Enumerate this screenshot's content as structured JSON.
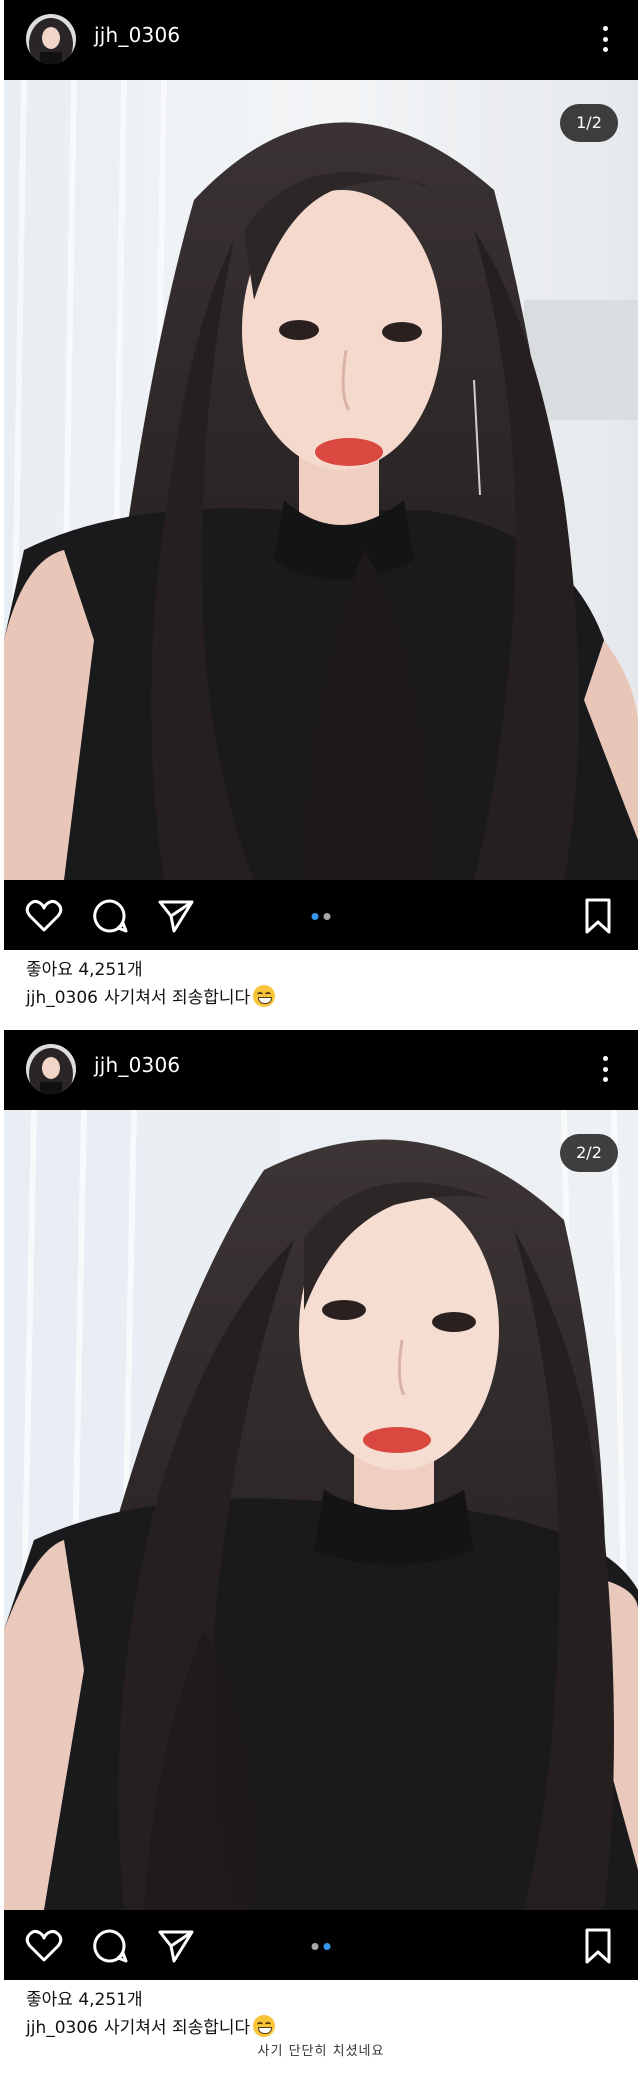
{
  "posts": [
    {
      "username": "jjh_0306",
      "counter": "1/2",
      "likes": "좋아요 4,251개",
      "caption_user": "jjh_0306",
      "caption_text": "사기쳐서 죄송합니다",
      "active_dot": 0
    },
    {
      "username": "jjh_0306",
      "counter": "2/2",
      "likes": "좋아요 4,251개",
      "caption_user": "jjh_0306",
      "caption_text": "사기쳐서 죄송합니다",
      "active_dot": 1
    }
  ],
  "footer": {
    "caption": "사기 단단히 치셨네요"
  },
  "icons": {
    "more": "more-options-icon",
    "like": "heart-icon",
    "comment": "comment-icon",
    "share": "send-icon",
    "save": "bookmark-icon",
    "emoji": "grinning-sweat-emoji"
  },
  "colors": {
    "bar_background": "#000000",
    "icon": "#ffffff",
    "dot_active": "#3897f0",
    "dot_inactive": "#a8a8a8",
    "counter_bg": "#1e1e1e"
  }
}
